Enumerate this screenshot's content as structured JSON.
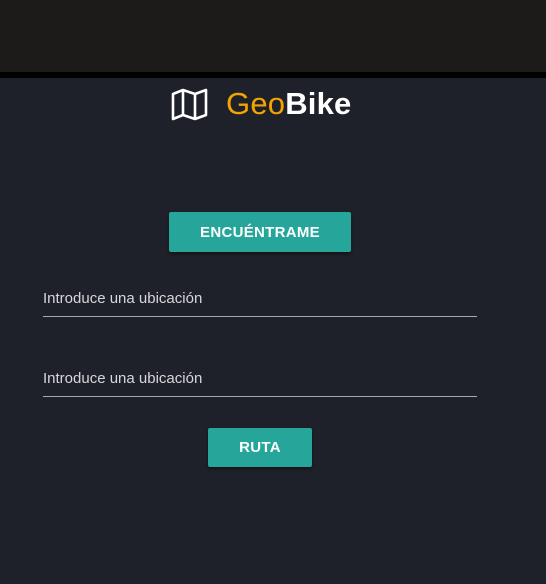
{
  "header": {
    "brand_part1": "Geo",
    "brand_part2": "Bike",
    "brand_icon": "map-icon",
    "brand_accent_color": "#f5a300"
  },
  "main": {
    "locate_button_label": "ENCUÉNTRAME",
    "origin_input": {
      "placeholder": "Introduce una ubicación",
      "value": ""
    },
    "destination_input": {
      "placeholder": "Introduce una ubicación",
      "value": ""
    },
    "route_button_label": "RUTA"
  },
  "colors": {
    "background": "#1f212a",
    "top_bar": "#1c1b19",
    "button": "#26a69a",
    "text": "#ffffff"
  }
}
